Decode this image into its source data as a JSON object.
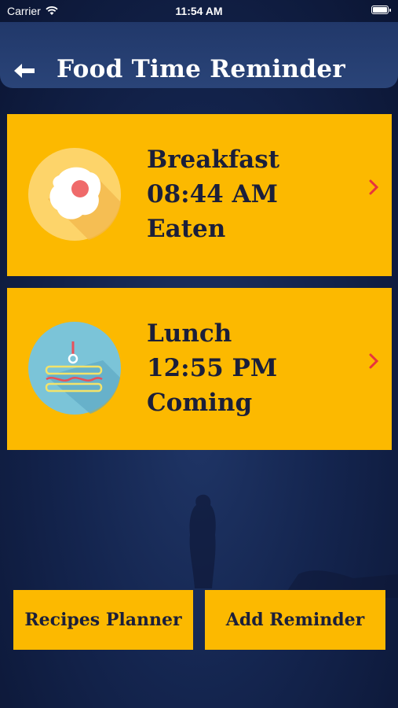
{
  "status_bar": {
    "carrier": "Carrier",
    "time": "11:54 AM"
  },
  "header": {
    "title": "Food Time Reminder",
    "back_icon": "arrow-left-icon"
  },
  "meals": [
    {
      "name": "Breakfast",
      "time": "08:44 AM",
      "status": "Eaten",
      "icon": "fried-egg-icon"
    },
    {
      "name": "Lunch",
      "time": "12:55 PM",
      "status": "Coming",
      "icon": "sandwich-icon"
    }
  ],
  "buttons": {
    "recipes_planner": "Recipes Planner",
    "add_reminder": "Add Reminder"
  },
  "colors": {
    "card": "#fcb900",
    "text_dark": "#1b1f3a",
    "chevron": "#e8343c",
    "background": "#14254f"
  }
}
